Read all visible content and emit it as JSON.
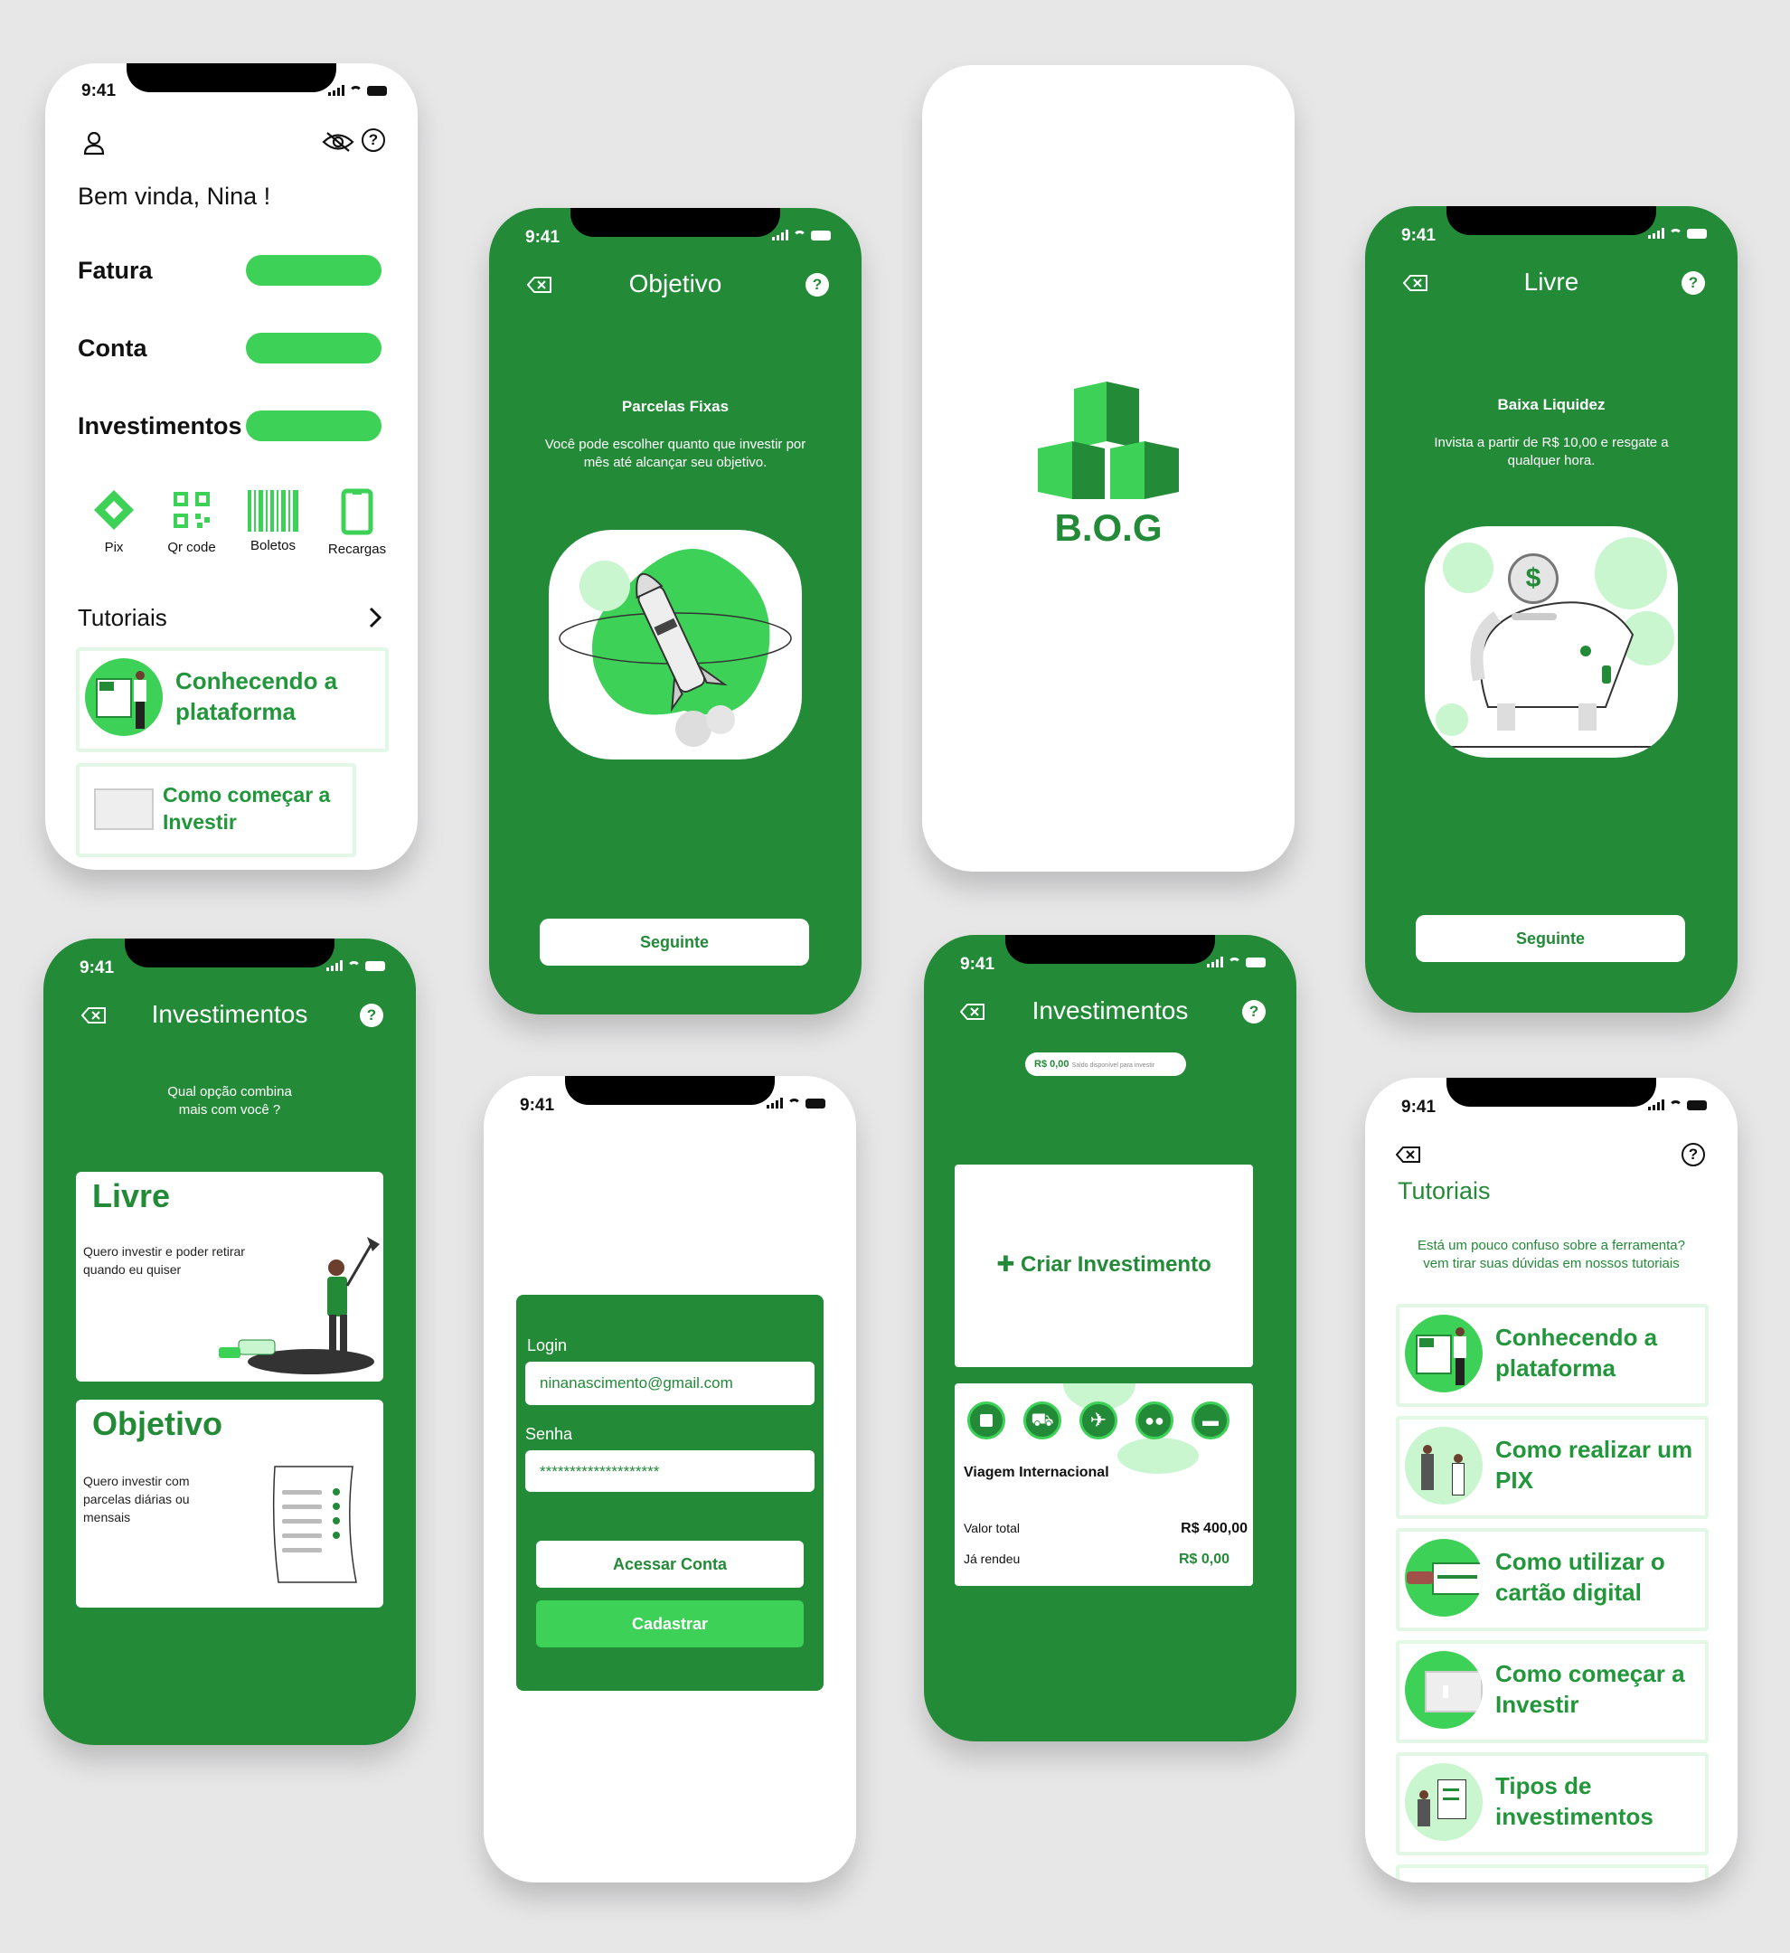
{
  "status": {
    "time": "9:41"
  },
  "home": {
    "greeting": "Bem vinda, Nina !",
    "rows": [
      {
        "label": "Fatura"
      },
      {
        "label": "Conta"
      },
      {
        "label": "Investimentos"
      }
    ],
    "shortcuts": [
      {
        "label": "Pix",
        "icon": "pix-icon"
      },
      {
        "label": "Qr code",
        "icon": "qr-code-icon"
      },
      {
        "label": "Boletos",
        "icon": "barcode-icon"
      },
      {
        "label": "Recargas",
        "icon": "phone-icon"
      }
    ],
    "tutorials_title": "Tutoriais",
    "tutorials": [
      {
        "label": "Conhecendo a plataforma"
      },
      {
        "label": "Como começar a Investir"
      }
    ]
  },
  "objetivo": {
    "title": "Objetivo",
    "heading": "Parcelas Fixas",
    "body": "Você pode escolher quanto que investir por mês até alcançar seu objetivo.",
    "button": "Seguinte"
  },
  "splash": {
    "logo": "B.O.G"
  },
  "livre": {
    "title": "Livre",
    "heading": "Baixa Liquidez",
    "body": "Invista a partir de R$ 10,00 e resgate a qualquer hora.",
    "button": "Seguinte",
    "coin": "$"
  },
  "investimentos": {
    "title": "Investimentos",
    "question": "Qual opção combina mais com você ?",
    "options": [
      {
        "title": "Livre",
        "desc": "Quero investir e poder retirar quando eu quiser"
      },
      {
        "title": "Objetivo",
        "desc": "Quero investir com parcelas diárias ou mensais"
      }
    ]
  },
  "login": {
    "login_label": "Login",
    "login_value": "ninanascimento@gmail.com",
    "password_label": "Senha",
    "password_value": "********************",
    "access_button": "Acessar Conta",
    "register_button": "Cadastrar"
  },
  "invest_dash": {
    "title": "Investimentos",
    "balance": "R$ 0,00",
    "balance_note": "Saldo disponível para investir",
    "create_button": "Criar Investimento",
    "goal_name": "Viagem Internacional",
    "total_label": "Valor total",
    "total_value": "R$ 400,00",
    "earned_label": "Já rendeu",
    "earned_value": "R$ 0,00"
  },
  "tutoriais": {
    "title": "Tutoriais",
    "subtitle": "Está um pouco confuso sobre a ferramenta? vem tirar suas dúvidas em nossos tutoriais",
    "items": [
      {
        "label": "Conhecendo a plataforma"
      },
      {
        "label": "Como realizar um PIX"
      },
      {
        "label": "Como utilizar o cartão digital"
      },
      {
        "label": "Como começar a Investir"
      },
      {
        "label": "Tipos de investimentos"
      }
    ]
  },
  "colors": {
    "primary": "#238a38",
    "accent": "#3dd157",
    "light": "#c9f5cf"
  }
}
